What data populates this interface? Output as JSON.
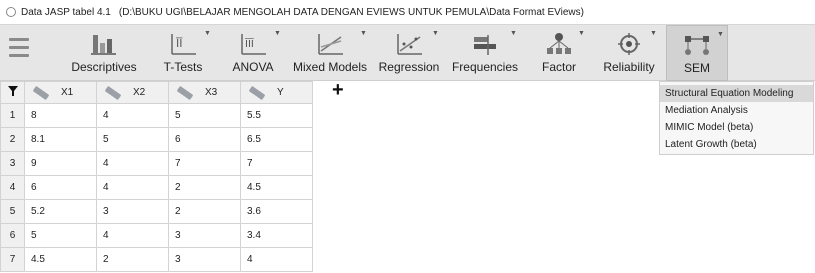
{
  "window": {
    "name": "Data JASP tabel 4.1",
    "path": "(D:\\BUKU UGI\\BELAJAR MENGOLAH DATA DENGAN EVIEWS UNTUK PEMULA\\Data Format EViews)"
  },
  "ribbon": {
    "buttons": [
      {
        "label": "Descriptives",
        "icon": "descriptives-icon"
      },
      {
        "label": "T-Tests",
        "icon": "ttest-icon"
      },
      {
        "label": "ANOVA",
        "icon": "anova-icon"
      },
      {
        "label": "Mixed Models",
        "icon": "mixed-models-icon"
      },
      {
        "label": "Regression",
        "icon": "regression-icon"
      },
      {
        "label": "Frequencies",
        "icon": "frequencies-icon"
      },
      {
        "label": "Factor",
        "icon": "factor-icon"
      },
      {
        "label": "Reliability",
        "icon": "reliability-icon"
      },
      {
        "label": "SEM",
        "icon": "sem-icon"
      }
    ]
  },
  "sem_menu": {
    "items": [
      "Structural Equation Modeling",
      "Mediation Analysis",
      "MIMIC Model (beta)",
      "Latent Growth (beta)"
    ]
  },
  "table": {
    "columns": [
      "X1",
      "X2",
      "X3",
      "Y"
    ],
    "rows": [
      {
        "n": "1",
        "cells": [
          "8",
          "4",
          "5",
          "5.5"
        ]
      },
      {
        "n": "2",
        "cells": [
          "8.1",
          "5",
          "6",
          "6.5"
        ]
      },
      {
        "n": "3",
        "cells": [
          "9",
          "4",
          "7",
          "7"
        ]
      },
      {
        "n": "4",
        "cells": [
          "6",
          "4",
          "2",
          "4.5"
        ]
      },
      {
        "n": "5",
        "cells": [
          "5.2",
          "3",
          "2",
          "3.6"
        ]
      },
      {
        "n": "6",
        "cells": [
          "5",
          "4",
          "3",
          "3.4"
        ]
      },
      {
        "n": "7",
        "cells": [
          "4.5",
          "2",
          "3",
          "4"
        ]
      }
    ]
  }
}
